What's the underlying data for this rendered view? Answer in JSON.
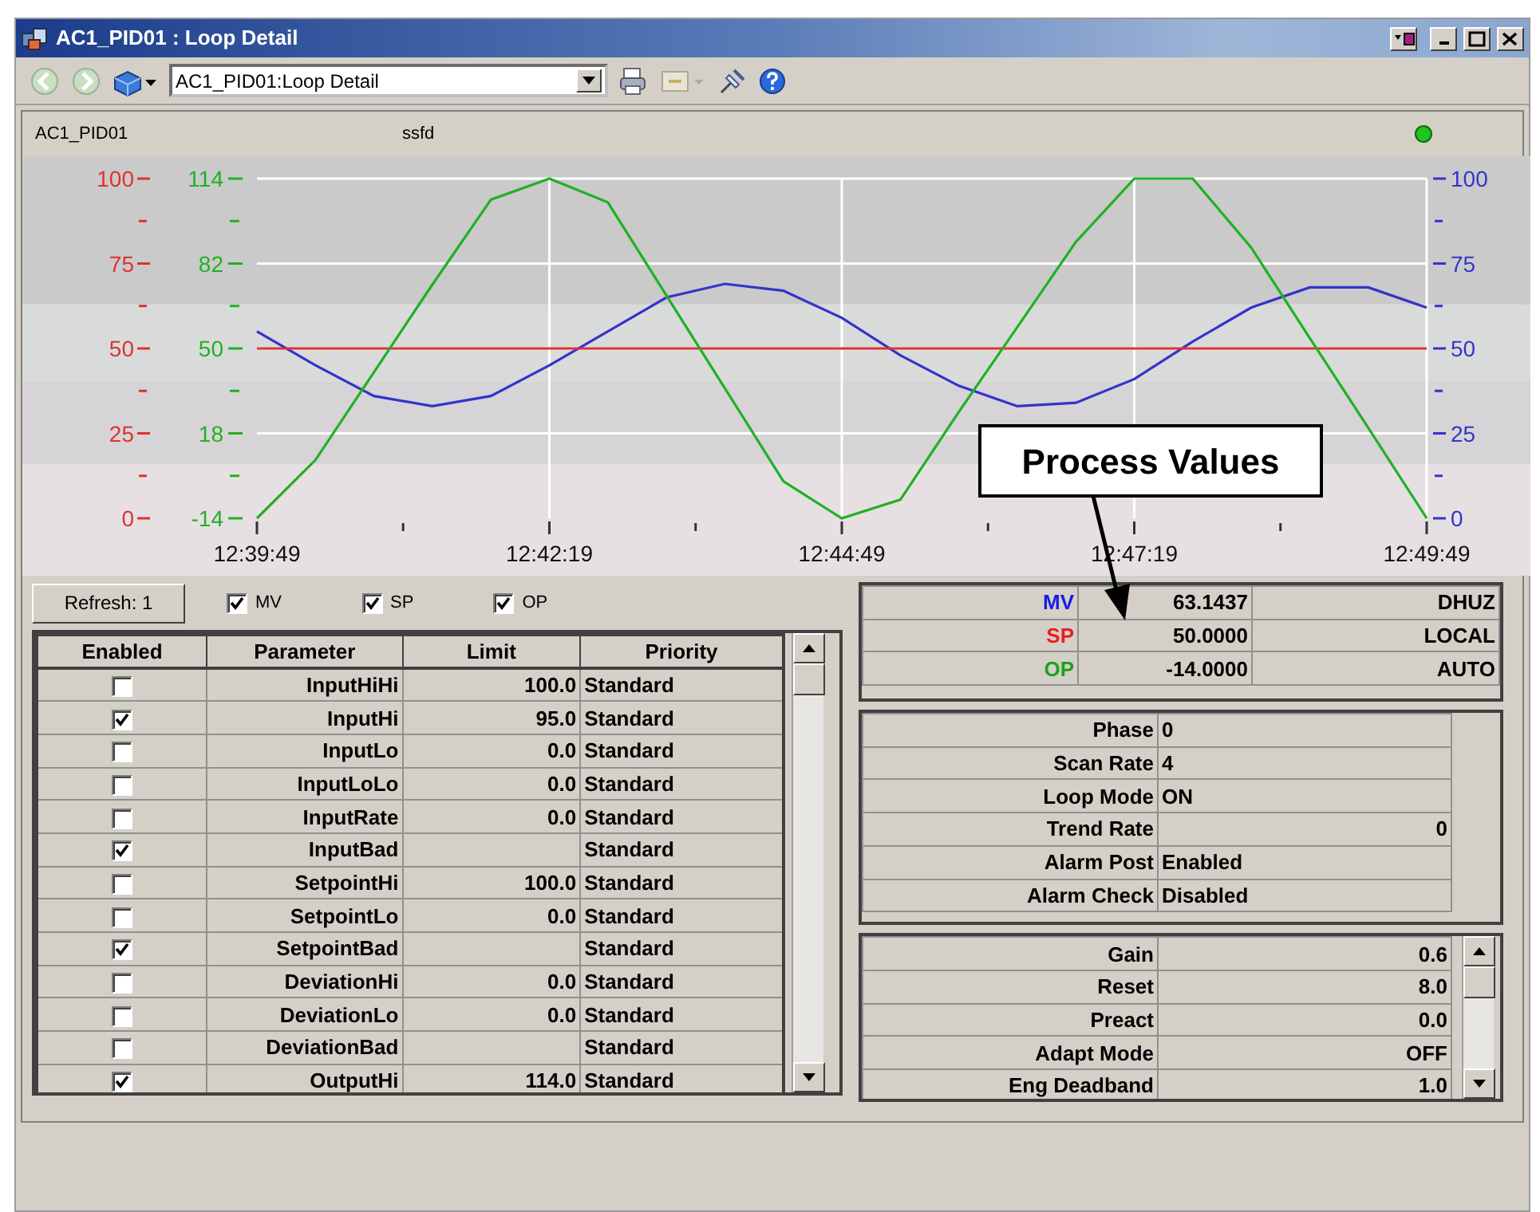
{
  "window": {
    "title": "AC1_PID01 : Loop Detail"
  },
  "toolbar": {
    "location": "AC1_PID01:Loop Detail"
  },
  "trend": {
    "tag": "AC1_PID01",
    "description": "ssfd",
    "status_on": true,
    "left_axes": [
      {
        "color": "#e03030",
        "labels": [
          "100",
          "75",
          "50",
          "25",
          "0"
        ]
      },
      {
        "color": "#22b022",
        "labels": [
          "114",
          "82",
          "50",
          "18",
          "-14"
        ]
      }
    ],
    "chart_data": {
      "type": "line",
      "categories": [
        "12:39:49",
        null,
        null,
        null,
        null,
        "12:42:19",
        null,
        null,
        null,
        null,
        "12:44:49",
        null,
        null,
        null,
        null,
        "12:47:19",
        null,
        null,
        null,
        null,
        "12:49:49"
      ],
      "ylim": [
        0,
        100
      ],
      "yticks": [
        0,
        25,
        50,
        75,
        100
      ],
      "grid": true,
      "bands": [
        {
          "axis": "y",
          "from": 63,
          "to": 100,
          "color": "#cacaca"
        },
        {
          "axis": "y",
          "from": 40,
          "to": 63,
          "color": "#d9dbdb"
        },
        {
          "axis": "y",
          "from": 16,
          "to": 40,
          "color": "#d6d4d6"
        },
        {
          "axis": "y",
          "from": 0,
          "to": 16,
          "color": "#e6e0e3"
        }
      ],
      "series": [
        {
          "name": "MV",
          "color": "#3333cc",
          "values": [
            55,
            45,
            36,
            33,
            36,
            45,
            55,
            65,
            69,
            67,
            59,
            48,
            39,
            33,
            34,
            41,
            52,
            62,
            68,
            68,
            62
          ]
        },
        {
          "name": "SP",
          "color": "#e03030",
          "values": [
            50,
            50,
            50,
            50,
            50,
            50,
            50,
            50,
            50,
            50,
            50,
            50,
            50,
            50,
            50,
            50,
            50,
            50,
            50,
            50,
            50
          ]
        },
        {
          "name": "OP",
          "color": "#22b022",
          "values": [
            0,
            17.2,
            43,
            68.8,
            93.8,
            100,
            93,
            65.6,
            38.3,
            10.9,
            0,
            5.5,
            31.3,
            56.3,
            81.3,
            100,
            100,
            79.7,
            53.1,
            26.6,
            0
          ]
        }
      ]
    }
  },
  "pens": [
    {
      "checked": true
    },
    {
      "checked": true
    },
    {
      "checked": true
    }
  ],
  "refresh_button": "Refresh: 1",
  "alarms": {
    "columns": [
      "Enabled",
      "Parameter",
      "Limit",
      "Priority"
    ],
    "rows": [
      {
        "enabled": false,
        "parameter": "InputHiHi",
        "limit": "100.0",
        "priority": "Standard"
      },
      {
        "enabled": true,
        "parameter": "InputHi",
        "limit": "95.0",
        "priority": "Standard"
      },
      {
        "enabled": false,
        "parameter": "InputLo",
        "limit": "0.0",
        "priority": "Standard"
      },
      {
        "enabled": false,
        "parameter": "InputLoLo",
        "limit": "0.0",
        "priority": "Standard"
      },
      {
        "enabled": false,
        "parameter": "InputRate",
        "limit": "0.0",
        "priority": "Standard"
      },
      {
        "enabled": true,
        "parameter": "InputBad",
        "priority": "Standard"
      },
      {
        "enabled": false,
        "parameter": "SetpointHi",
        "limit": "100.0",
        "priority": "Standard"
      },
      {
        "enabled": false,
        "parameter": "SetpointLo",
        "limit": "0.0",
        "priority": "Standard"
      },
      {
        "enabled": true,
        "parameter": "SetpointBad",
        "priority": "Standard"
      },
      {
        "enabled": false,
        "parameter": "DeviationHi",
        "limit": "0.0",
        "priority": "Standard"
      },
      {
        "enabled": false,
        "parameter": "DeviationLo",
        "limit": "0.0",
        "priority": "Standard"
      },
      {
        "enabled": false,
        "parameter": "DeviationBad",
        "priority": "Standard"
      },
      {
        "enabled": true,
        "parameter": "OutputHi",
        "limit": "114.0",
        "priority": "Standard"
      }
    ]
  },
  "process_values": [
    {
      "label": "MV",
      "color": "#1a1ae6",
      "value": "63.1437",
      "mode": "DHUZ"
    },
    {
      "label": "SP",
      "color": "#e62020",
      "value": "50.0000",
      "mode": "LOCAL"
    },
    {
      "label": "OP",
      "color": "#1fa01f",
      "value": "-14.0000",
      "mode": "AUTO"
    }
  ],
  "status": [
    {
      "label": "Phase",
      "value": "0",
      "kind": "text"
    },
    {
      "label": "Scan Rate",
      "value": "4",
      "kind": "text"
    },
    {
      "label": "Loop Mode",
      "value": "ON",
      "kind": "text"
    },
    {
      "label": "Trend Rate",
      "value": "0",
      "kind": "number"
    },
    {
      "label": "Alarm Post",
      "value": "Enabled",
      "kind": "text"
    },
    {
      "label": "Alarm Check",
      "value": "Disabled",
      "kind": "text"
    }
  ],
  "tuning": [
    {
      "label": "Gain",
      "value": "0.6"
    },
    {
      "label": "Reset",
      "value": "8.0"
    },
    {
      "label": "Preact",
      "value": "0.0"
    },
    {
      "label": "Adapt Mode",
      "value": "OFF"
    },
    {
      "label": "Eng Deadband",
      "value": "1.0"
    }
  ],
  "callout": {
    "text": "Process Values"
  }
}
